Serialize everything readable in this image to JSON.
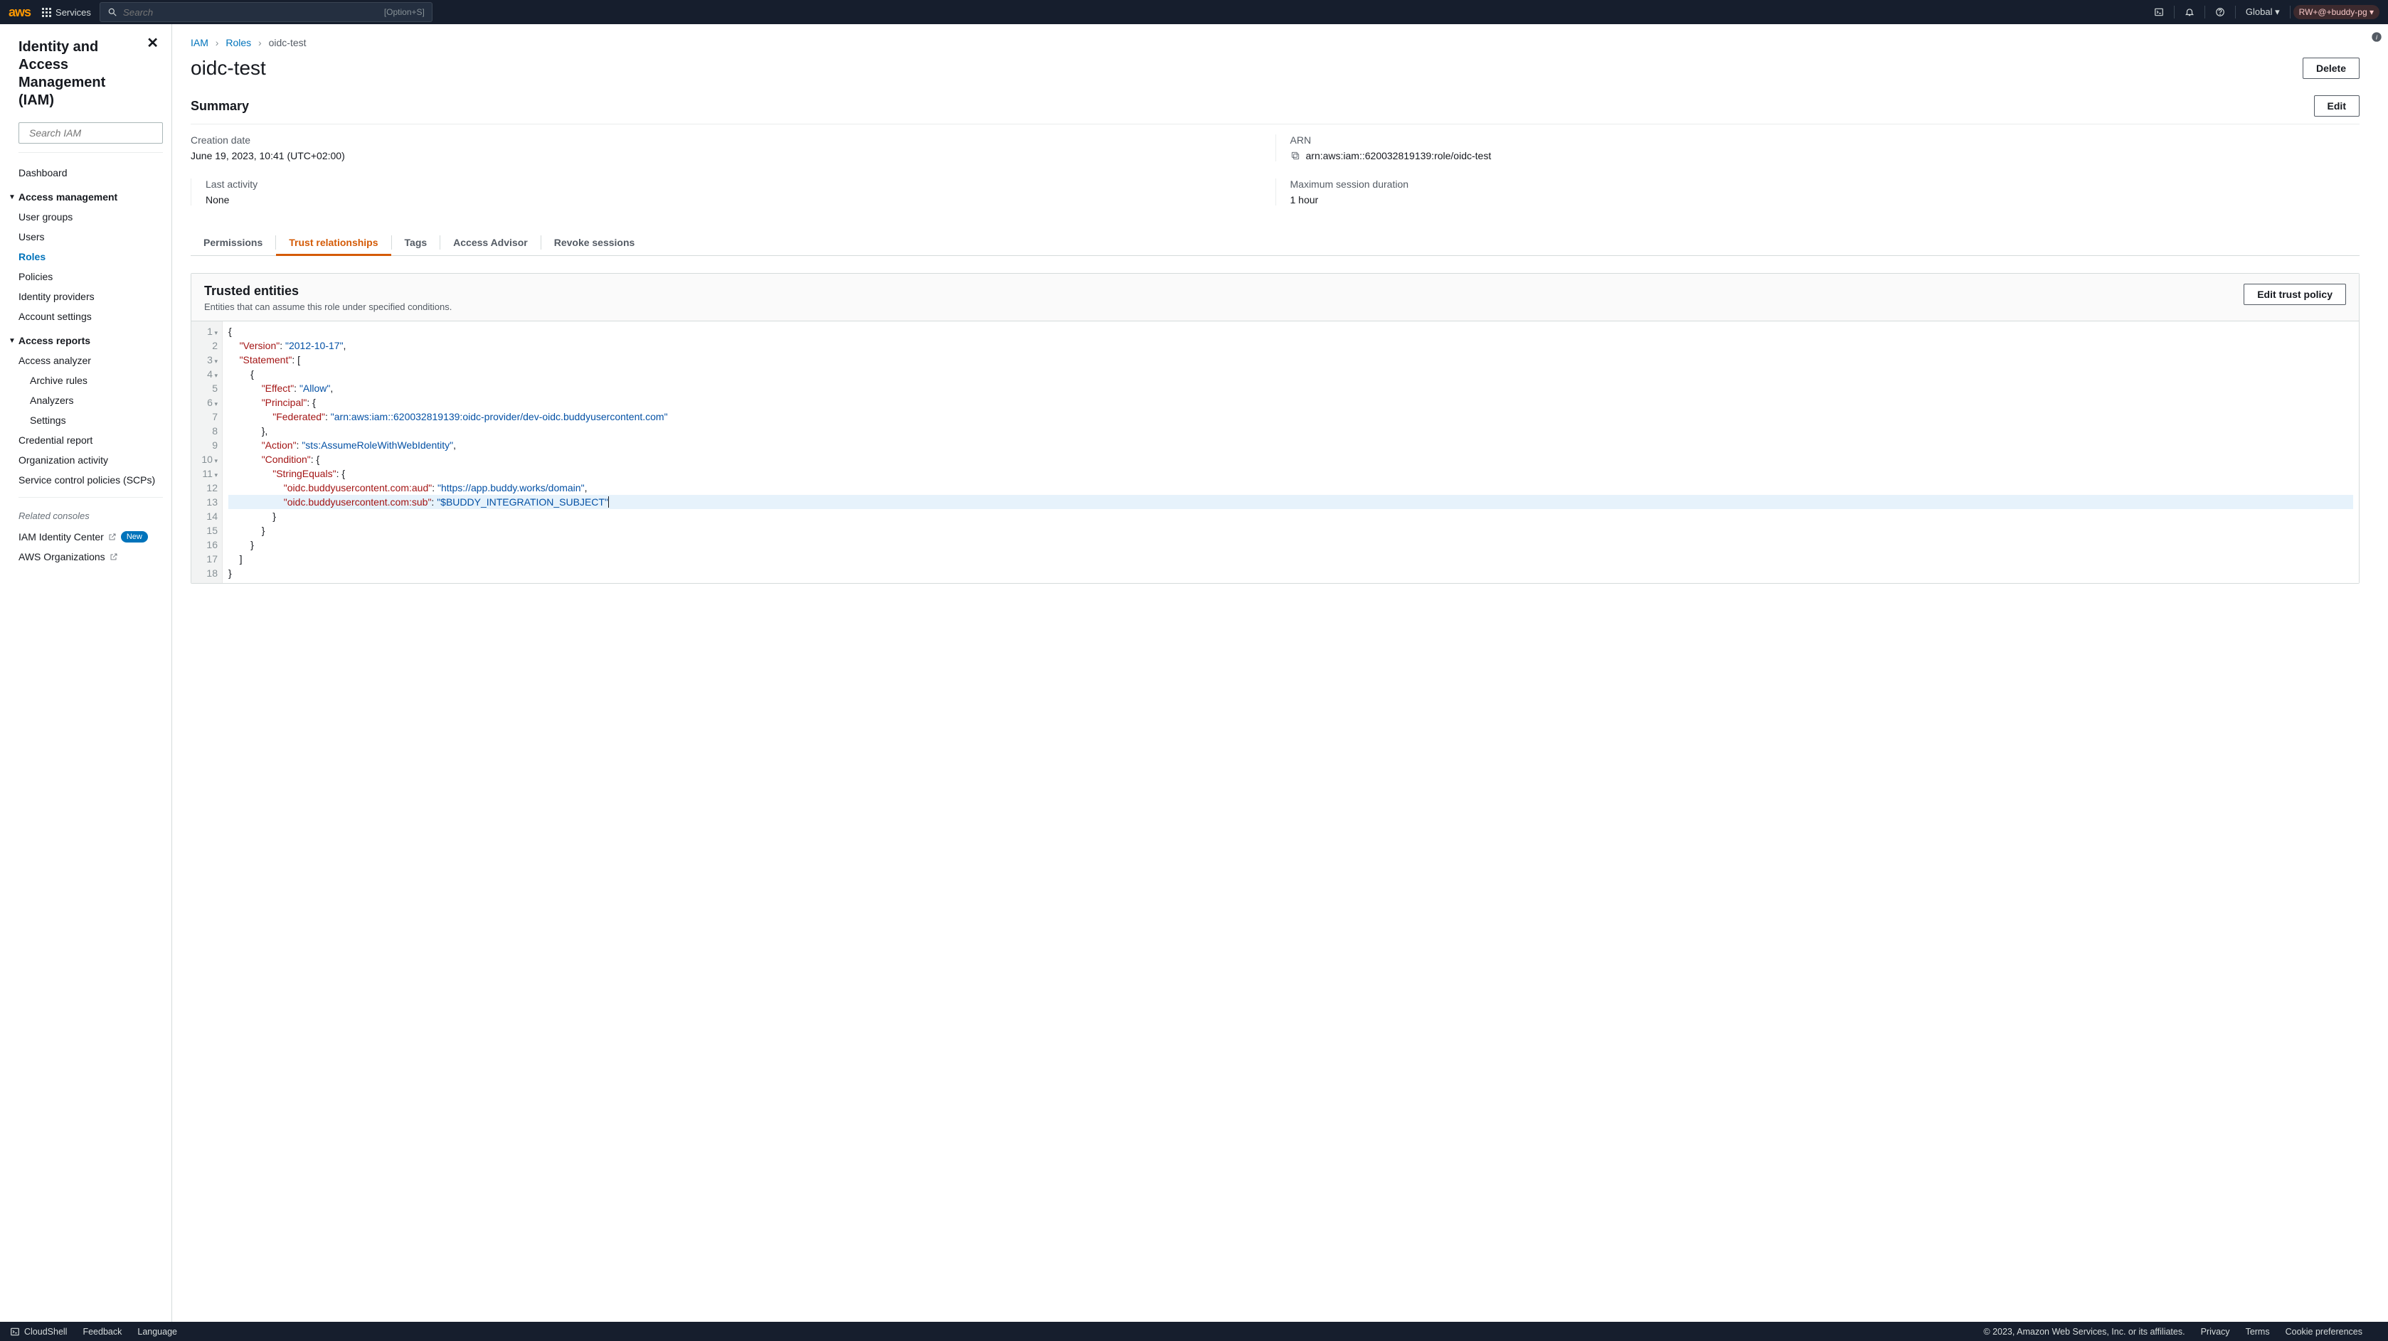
{
  "topnav": {
    "services": "Services",
    "search_placeholder": "Search",
    "search_hint": "[Option+S]",
    "region": "Global",
    "account": "RW+@+buddy-pg"
  },
  "sidebar": {
    "title": "Identity and Access Management (IAM)",
    "search_placeholder": "Search IAM",
    "dashboard": "Dashboard",
    "group_access_mgmt": "Access management",
    "access_mgmt_items": {
      "user_groups": "User groups",
      "users": "Users",
      "roles": "Roles",
      "policies": "Policies",
      "identity_providers": "Identity providers",
      "account_settings": "Account settings"
    },
    "group_access_reports": "Access reports",
    "access_reports_items": {
      "access_analyzer": "Access analyzer",
      "archive_rules": "Archive rules",
      "analyzers": "Analyzers",
      "settings": "Settings",
      "credential_report": "Credential report",
      "organization_activity": "Organization activity",
      "scps": "Service control policies (SCPs)"
    },
    "related_label": "Related consoles",
    "related_items": {
      "identity_center": "IAM Identity Center",
      "new_badge": "New",
      "aws_orgs": "AWS Organizations"
    }
  },
  "crumbs": {
    "iam": "IAM",
    "roles": "Roles",
    "current": "oidc-test"
  },
  "page": {
    "title": "oidc-test",
    "delete_btn": "Delete",
    "summary_heading": "Summary",
    "edit_btn": "Edit",
    "summary": {
      "creation_label": "Creation date",
      "creation_val": "June 19, 2023, 10:41 (UTC+02:00)",
      "arn_label": "ARN",
      "arn_val": "arn:aws:iam::620032819139:role/oidc-test",
      "last_activity_label": "Last activity",
      "last_activity_val": "None",
      "max_session_label": "Maximum session duration",
      "max_session_val": "1 hour"
    },
    "tabs": {
      "permissions": "Permissions",
      "trust": "Trust relationships",
      "tags": "Tags",
      "advisor": "Access Advisor",
      "revoke": "Revoke sessions"
    },
    "trusted": {
      "heading": "Trusted entities",
      "subheading": "Entities that can assume this role under specified conditions.",
      "edit_btn": "Edit trust policy"
    }
  },
  "code_lines": [
    {
      "n": "1",
      "fold": true,
      "html": "<span class='p'>{</span>"
    },
    {
      "n": "2",
      "html": "    <span class='k'>\"Version\"</span><span class='p'>: </span><span class='s'>\"2012-10-17\"</span><span class='p'>,</span>"
    },
    {
      "n": "3",
      "fold": true,
      "html": "    <span class='k'>\"Statement\"</span><span class='p'>: [</span>"
    },
    {
      "n": "4",
      "fold": true,
      "html": "        <span class='p'>{</span>"
    },
    {
      "n": "5",
      "html": "            <span class='k'>\"Effect\"</span><span class='p'>: </span><span class='s'>\"Allow\"</span><span class='p'>,</span>"
    },
    {
      "n": "6",
      "fold": true,
      "html": "            <span class='k'>\"Principal\"</span><span class='p'>: {</span>"
    },
    {
      "n": "7",
      "html": "                <span class='k'>\"Federated\"</span><span class='p'>: </span><span class='s'>\"arn:aws:iam::620032819139:oidc-provider/dev-oidc.buddyusercontent.com\"</span>"
    },
    {
      "n": "8",
      "html": "            <span class='p'>},</span>"
    },
    {
      "n": "9",
      "html": "            <span class='k'>\"Action\"</span><span class='p'>: </span><span class='s'>\"sts:AssumeRoleWithWebIdentity\"</span><span class='p'>,</span>"
    },
    {
      "n": "10",
      "fold": true,
      "html": "            <span class='k'>\"Condition\"</span><span class='p'>: {</span>"
    },
    {
      "n": "11",
      "fold": true,
      "html": "                <span class='k'>\"StringEquals\"</span><span class='p'>: {</span>"
    },
    {
      "n": "12",
      "html": "                    <span class='k'>\"oidc.buddyusercontent.com:aud\"</span><span class='p'>: </span><span class='s'>\"https://app.buddy.works/domain\"</span><span class='p'>,</span>"
    },
    {
      "n": "13",
      "hl": true,
      "html": "                    <span class='k'>\"oidc.buddyusercontent.com:sub\"</span><span class='p'>: </span><span class='s'>\"$BUDDY_INTEGRATION_SUBJECT\"</span><span class='cursor'></span>"
    },
    {
      "n": "14",
      "html": "                <span class='p'>}</span>"
    },
    {
      "n": "15",
      "html": "            <span class='p'>}</span>"
    },
    {
      "n": "16",
      "html": "        <span class='p'>}</span>"
    },
    {
      "n": "17",
      "html": "    <span class='p'>]</span>"
    },
    {
      "n": "18",
      "html": "<span class='p'>}</span>"
    }
  ],
  "footer": {
    "cloudshell": "CloudShell",
    "feedback": "Feedback",
    "language": "Language",
    "copyright": "© 2023, Amazon Web Services, Inc. or its affiliates.",
    "privacy": "Privacy",
    "terms": "Terms",
    "cookies": "Cookie preferences"
  }
}
